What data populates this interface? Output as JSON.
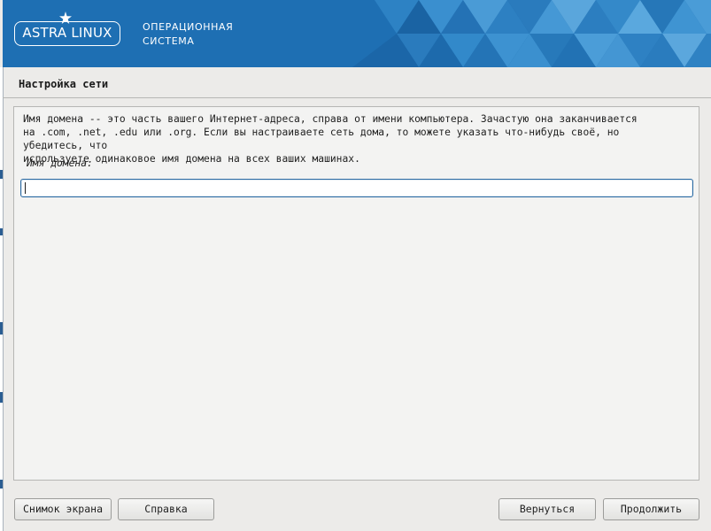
{
  "header": {
    "logo_text": "ASTRA LINUX",
    "subtitle_line1": "ОПЕРАЦИОННАЯ",
    "subtitle_line2": "СИСТЕМА"
  },
  "page": {
    "title": "Настройка сети"
  },
  "main": {
    "description": "Имя домена -- это часть вашего Интернет-адреса, справа от имени компьютера. Зачастую она заканчивается\nна .com, .net, .edu или .org. Если вы настраиваете сеть дома, то можете указать что-нибудь своё, но убедитесь, что\nиспользуете одинаковое имя домена на всех ваших машинах.",
    "field_label": "Имя домена:",
    "domain_value": ""
  },
  "footer": {
    "screenshot_label": "Снимок экрана",
    "help_label": "Справка",
    "back_label": "Вернуться",
    "continue_label": "Продолжить"
  },
  "colors": {
    "header_blue": "#1e6fb3",
    "input_border": "#2b6aa3",
    "background": "#ecebe9"
  }
}
